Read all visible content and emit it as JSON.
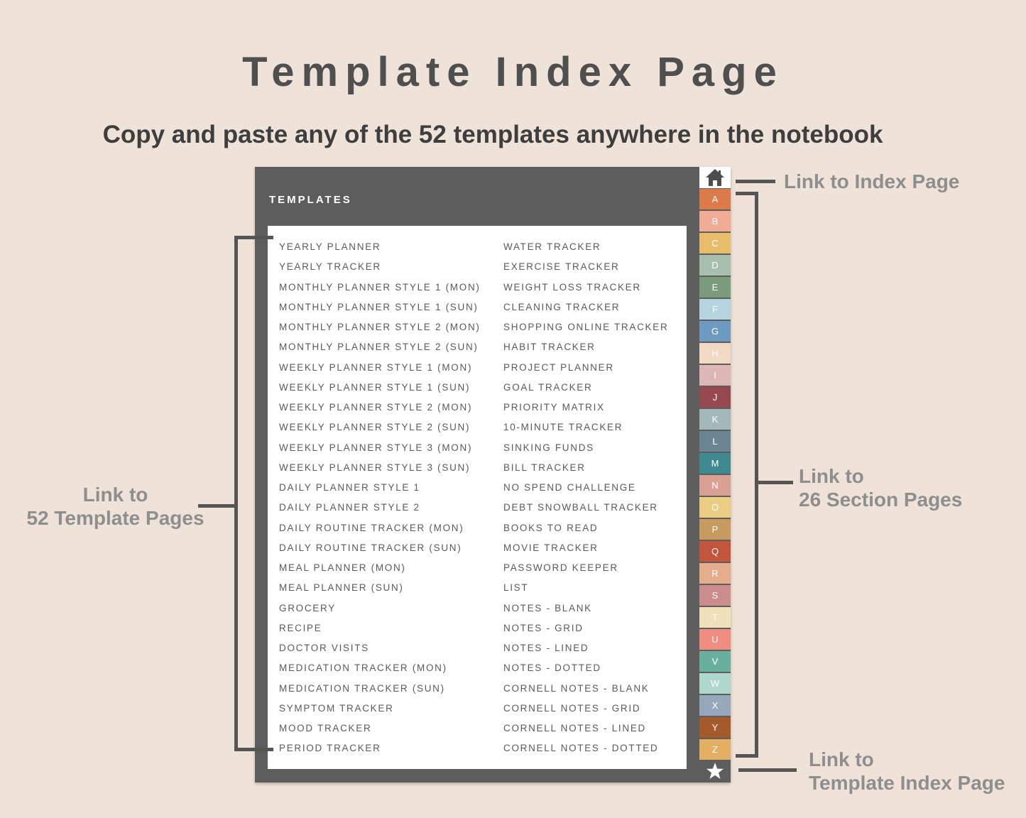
{
  "title": "Template Index Page",
  "subtitle": "Copy and paste any of the 52 templates anywhere in the notebook",
  "notebook": {
    "header": "TEMPLATES",
    "left_column": [
      "YEARLY PLANNER",
      "YEARLY TRACKER",
      "MONTHLY PLANNER STYLE 1 (MON)",
      "MONTHLY PLANNER STYLE 1 (SUN)",
      "MONTHLY PLANNER STYLE 2 (MON)",
      "MONTHLY PLANNER STYLE 2 (SUN)",
      "WEEKLY PLANNER STYLE 1 (MON)",
      "WEEKLY PLANNER STYLE 1 (SUN)",
      "WEEKLY PLANNER STYLE 2 (MON)",
      "WEEKLY PLANNER STYLE 2 (SUN)",
      "WEEKLY PLANNER STYLE 3 (MON)",
      "WEEKLY PLANNER STYLE 3 (SUN)",
      "DAILY PLANNER STYLE 1",
      "DAILY PLANNER STYLE 2",
      "DAILY ROUTINE TRACKER (MON)",
      "DAILY ROUTINE TRACKER (SUN)",
      "MEAL PLANNER (MON)",
      "MEAL PLANNER (SUN)",
      "GROCERY",
      "RECIPE",
      "DOCTOR VISITS",
      "MEDICATION TRACKER (MON)",
      "MEDICATION TRACKER (SUN)",
      "SYMPTOM TRACKER",
      "MOOD TRACKER",
      "PERIOD TRACKER"
    ],
    "right_column": [
      "WATER TRACKER",
      "EXERCISE TRACKER",
      "WEIGHT LOSS TRACKER",
      "CLEANING TRACKER",
      "SHOPPING ONLINE TRACKER",
      "HABIT TRACKER",
      "PROJECT PLANNER",
      "GOAL TRACKER",
      "PRIORITY MATRIX",
      "10-MINUTE TRACKER",
      "SINKING FUNDS",
      "BILL TRACKER",
      "NO SPEND CHALLENGE",
      "DEBT SNOWBALL TRACKER",
      "BOOKS TO READ",
      "MOVIE TRACKER",
      "PASSWORD KEEPER",
      "LIST",
      "NOTES - BLANK",
      "NOTES - GRID",
      "NOTES - LINED",
      "NOTES - DOTTED",
      "CORNELL NOTES - BLANK",
      "CORNELL NOTES - GRID",
      "CORNELL NOTES - LINED",
      "CORNELL NOTES - DOTTED"
    ],
    "home_icon": "home-icon",
    "star_icon": "star-icon",
    "tabs": [
      {
        "letter": "A",
        "color": "#dd7a4a"
      },
      {
        "letter": "B",
        "color": "#f0ac94"
      },
      {
        "letter": "C",
        "color": "#e8bd6a"
      },
      {
        "letter": "D",
        "color": "#a7c0ae"
      },
      {
        "letter": "E",
        "color": "#7a9b7c"
      },
      {
        "letter": "F",
        "color": "#b6d3e0"
      },
      {
        "letter": "G",
        "color": "#6e9ac2"
      },
      {
        "letter": "H",
        "color": "#f2d9c3"
      },
      {
        "letter": "I",
        "color": "#ddb6b6"
      },
      {
        "letter": "J",
        "color": "#97494f"
      },
      {
        "letter": "K",
        "color": "#a3b8b8"
      },
      {
        "letter": "L",
        "color": "#6b8592"
      },
      {
        "letter": "M",
        "color": "#3f8a8e"
      },
      {
        "letter": "N",
        "color": "#d9a093"
      },
      {
        "letter": "O",
        "color": "#eccd84"
      },
      {
        "letter": "P",
        "color": "#c79a60"
      },
      {
        "letter": "Q",
        "color": "#c3553c"
      },
      {
        "letter": "R",
        "color": "#e6ad8d"
      },
      {
        "letter": "S",
        "color": "#cb8c8c"
      },
      {
        "letter": "T",
        "color": "#f1e1ba"
      },
      {
        "letter": "U",
        "color": "#ee8d80"
      },
      {
        "letter": "V",
        "color": "#68b09d"
      },
      {
        "letter": "W",
        "color": "#aed8cc"
      },
      {
        "letter": "X",
        "color": "#98a8bc"
      },
      {
        "letter": "Y",
        "color": "#a45a2a"
      },
      {
        "letter": "Z",
        "color": "#e3b063"
      }
    ]
  },
  "annotations": {
    "index_link": "Link to Index Page",
    "section_link_1": "Link to",
    "section_link_2": "26 Section Pages",
    "template_pages_1": "Link to",
    "template_pages_2": "52 Template Pages",
    "template_index_1": "Link to",
    "template_index_2": "Template Index Page"
  }
}
